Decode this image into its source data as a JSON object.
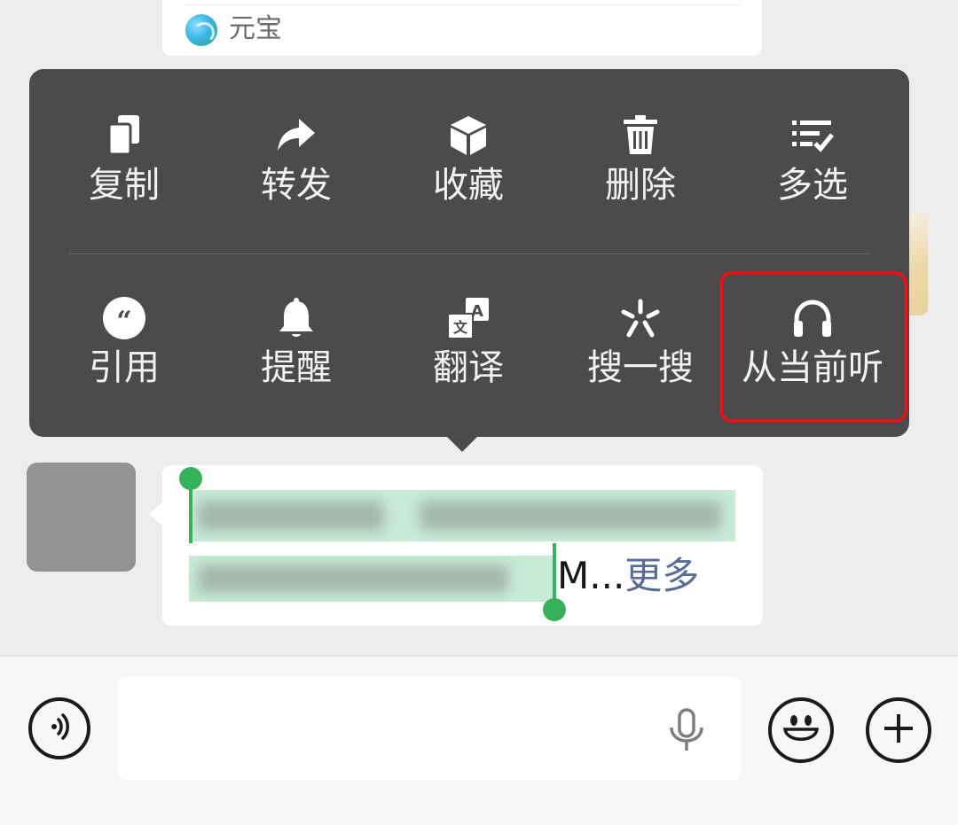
{
  "prev_message": {
    "sender_label": "元宝"
  },
  "context_menu": {
    "row1": [
      {
        "label": "复制",
        "icon": "copy-icon"
      },
      {
        "label": "转发",
        "icon": "forward-icon"
      },
      {
        "label": "收藏",
        "icon": "favorite-box-icon"
      },
      {
        "label": "删除",
        "icon": "trash-icon"
      },
      {
        "label": "多选",
        "icon": "multiselect-icon"
      }
    ],
    "row2": [
      {
        "label": "引用",
        "icon": "quote-icon"
      },
      {
        "label": "提醒",
        "icon": "bell-icon"
      },
      {
        "label": "翻译",
        "icon": "translate-icon"
      },
      {
        "label": "搜一搜",
        "icon": "search-spark-icon"
      },
      {
        "label": "从当前听",
        "icon": "headphones-icon"
      }
    ],
    "highlight_color": "#e1141c"
  },
  "message": {
    "tail_text": "M...",
    "more_link": "更多",
    "selection_color": "#37b25a"
  },
  "input_bar": {
    "voice_icon": "voice-mode-icon",
    "mic_icon": "microphone-icon",
    "emoji_icon": "emoji-icon",
    "plus_icon": "plus-icon"
  }
}
